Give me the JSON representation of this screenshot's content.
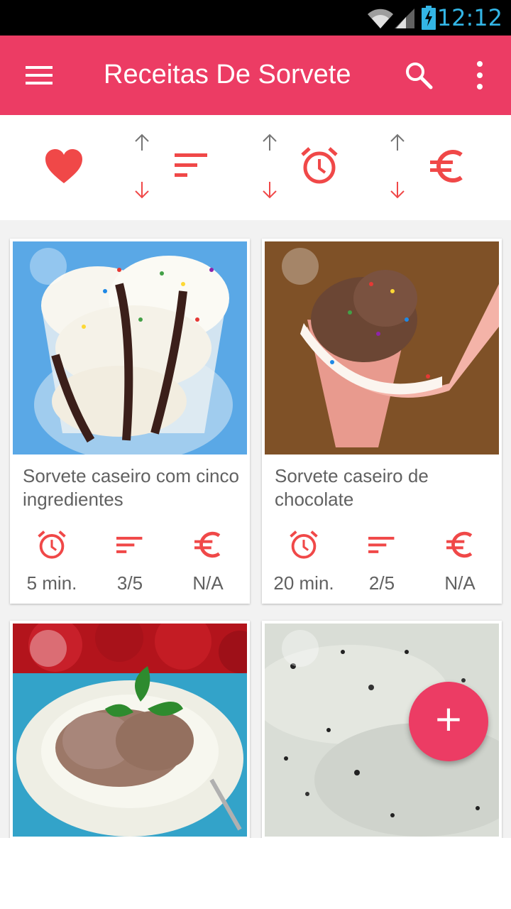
{
  "status_bar": {
    "time": "12:12"
  },
  "app_bar": {
    "title": "Receitas De Sorvete",
    "menu_icon": "hamburger-menu-icon",
    "search_icon": "search-icon",
    "more_icon": "more-vertical-icon"
  },
  "filters": [
    {
      "icon": "heart-icon",
      "sortable": false
    },
    {
      "icon": "difficulty-sort-icon",
      "sortable": true
    },
    {
      "icon": "alarm-clock-icon",
      "sortable": true
    },
    {
      "icon": "euro-icon",
      "sortable": true
    }
  ],
  "recipes": [
    {
      "title": "Sorvete caseiro com cinco ingredientes",
      "time": "5 min.",
      "difficulty": "3/5",
      "cost": "N/A"
    },
    {
      "title": "Sorvete caseiro de chocolate",
      "time": "20 min.",
      "difficulty": "2/5",
      "cost": "N/A"
    },
    {
      "title": "",
      "time": "",
      "difficulty": "",
      "cost": ""
    },
    {
      "title": "",
      "time": "",
      "difficulty": "",
      "cost": ""
    }
  ],
  "fab": {
    "label": "+"
  },
  "colors": {
    "accent": "#ec3c64",
    "icon_red": "#f04848",
    "status_blue": "#33b5e5"
  }
}
